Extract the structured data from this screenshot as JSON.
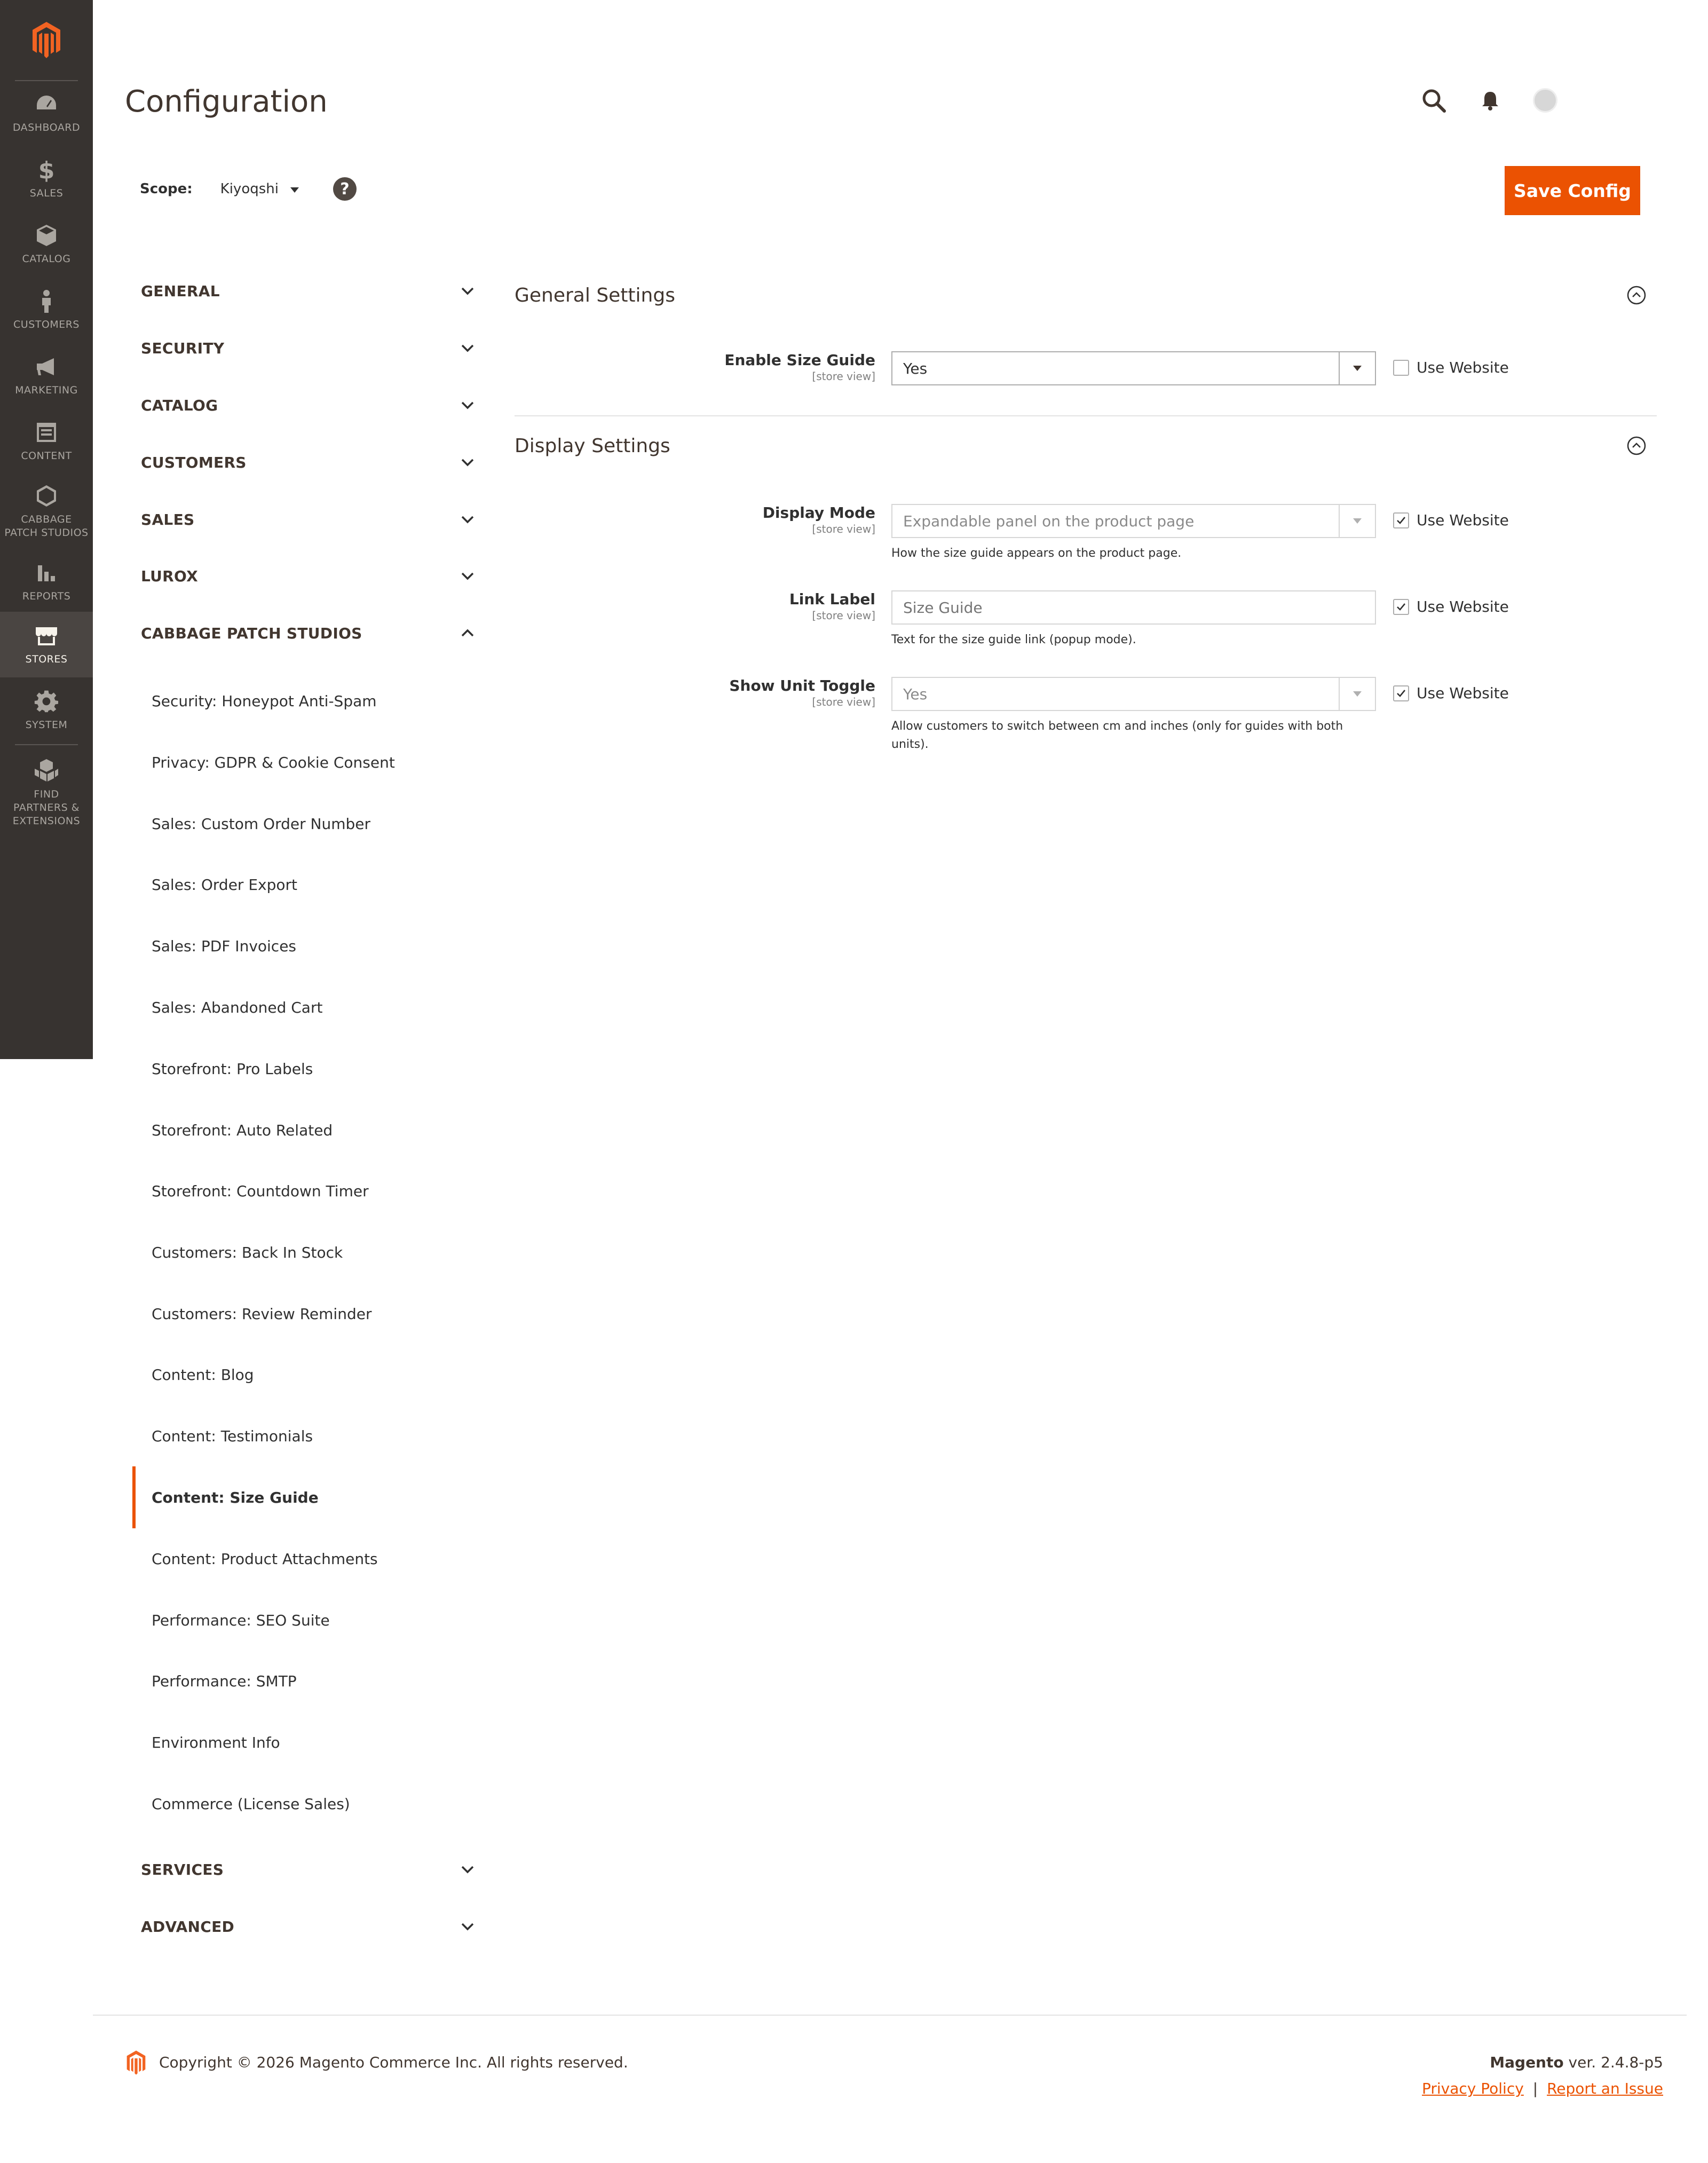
{
  "menu": {
    "items": [
      {
        "label": "Dashboard",
        "icon": "dashboard-icon"
      },
      {
        "label": "Sales",
        "icon": "dollar-icon"
      },
      {
        "label": "Catalog",
        "icon": "box-icon"
      },
      {
        "label": "Customers",
        "icon": "person-icon"
      },
      {
        "label": "Marketing",
        "icon": "megaphone-icon"
      },
      {
        "label": "Content",
        "icon": "layout-icon"
      },
      {
        "label": "Cabbage Patch Studios",
        "icon": "hexagon-icon"
      },
      {
        "label": "Reports",
        "icon": "bar-chart-icon"
      },
      {
        "label": "Stores",
        "icon": "storefront-icon",
        "active": true
      },
      {
        "label": "System",
        "icon": "gear-icon"
      },
      {
        "label": "Find Partners & Extensions",
        "icon": "cubes-icon"
      }
    ]
  },
  "header": {
    "title": "Configuration"
  },
  "scope": {
    "label": "Scope:",
    "value": "Kiyoqshi",
    "help": "?"
  },
  "actions": {
    "save_label": "Save Config"
  },
  "tabs": {
    "groups": [
      {
        "label": "GENERAL",
        "expanded": false
      },
      {
        "label": "SECURITY",
        "expanded": false
      },
      {
        "label": "CATALOG",
        "expanded": false
      },
      {
        "label": "CUSTOMERS",
        "expanded": false
      },
      {
        "label": "SALES",
        "expanded": false
      },
      {
        "label": "LUROX",
        "expanded": false
      },
      {
        "label": "CABBAGE PATCH STUDIOS",
        "expanded": true
      },
      {
        "label": "SERVICES",
        "expanded": false
      },
      {
        "label": "ADVANCED",
        "expanded": false
      }
    ],
    "cabbage_items": [
      "Security: Honeypot Anti-Spam",
      "Privacy: GDPR & Cookie Consent",
      "Sales: Custom Order Number",
      "Sales: Order Export",
      "Sales: PDF Invoices",
      "Sales: Abandoned Cart",
      "Storefront: Pro Labels",
      "Storefront: Auto Related",
      "Storefront: Countdown Timer",
      "Customers: Back In Stock",
      "Customers: Review Reminder",
      "Content: Blog",
      "Content: Testimonials",
      "Content: Size Guide",
      "Content: Product Attachments",
      "Performance: SEO Suite",
      "Performance: SMTP",
      "Environment Info",
      "Commerce (License Sales)"
    ],
    "active_item": "Content: Size Guide"
  },
  "sections": {
    "general": {
      "title": "General Settings",
      "fields": {
        "enable": {
          "label": "Enable Size Guide",
          "scope": "[store view]",
          "value": "Yes",
          "use_website_label": "Use Website",
          "use_website_checked": false
        }
      }
    },
    "display": {
      "title": "Display Settings",
      "fields": {
        "mode": {
          "label": "Display Mode",
          "scope": "[store view]",
          "value": "Expandable panel on the product page",
          "note": "How the size guide appears on the product page.",
          "use_website_label": "Use Website",
          "use_website_checked": true
        },
        "link": {
          "label": "Link Label",
          "scope": "[store view]",
          "placeholder": "Size Guide",
          "note": "Text for the size guide link (popup mode).",
          "use_website_label": "Use Website",
          "use_website_checked": true
        },
        "toggle": {
          "label": "Show Unit Toggle",
          "scope": "[store view]",
          "value": "Yes",
          "note": "Allow customers to switch between cm and inches (only for guides with both units).",
          "use_website_label": "Use Website",
          "use_website_checked": true
        }
      }
    }
  },
  "footer": {
    "copyright": "Copyright © 2026 Magento Commerce Inc. All rights reserved.",
    "brand": "Magento",
    "version": " ver. 2.4.8-p5",
    "privacy": "Privacy Policy",
    "separator": "|",
    "report": "Report an Issue"
  },
  "colors": {
    "accent": "#eb5202",
    "menu_bg": "#373330",
    "title_text": "#41362f"
  }
}
